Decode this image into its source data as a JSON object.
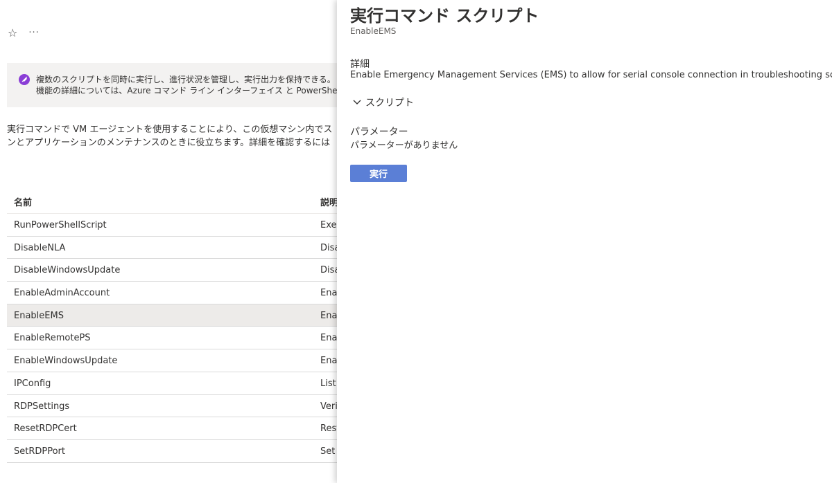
{
  "header": {
    "favorite_icon": "star-icon",
    "more_icon": "ellipsis-icon",
    "more_label": "···"
  },
  "info_banner": {
    "icon": "rocket-icon",
    "line1": "複数のスクリプトを同時に実行し、進行状況を管理し、実行出力を保持できる。",
    "line2": "機能の詳細については、Azure コマンド ライン インターフェイス と PowerShell"
  },
  "description": {
    "line1": "実行コマンドで VM エージェントを使用することにより、この仮想マシン内でス",
    "line2": "ンとアプリケーションのメンテナンスのときに役立ちます。詳細を確認するには"
  },
  "table": {
    "headers": [
      "名前",
      "説明"
    ],
    "rows": [
      {
        "name": "RunPowerShellScript",
        "desc": "Exec"
      },
      {
        "name": "DisableNLA",
        "desc": "Disa"
      },
      {
        "name": "DisableWindowsUpdate",
        "desc": "Disa"
      },
      {
        "name": "EnableAdminAccount",
        "desc": "Enal"
      },
      {
        "name": "EnableEMS",
        "desc": "Enal",
        "selected": true
      },
      {
        "name": "EnableRemotePS",
        "desc": "Enal"
      },
      {
        "name": "EnableWindowsUpdate",
        "desc": "Enal"
      },
      {
        "name": "IPConfig",
        "desc": "List"
      },
      {
        "name": "RDPSettings",
        "desc": "Veri"
      },
      {
        "name": "ResetRDPCert",
        "desc": "Rest"
      },
      {
        "name": "SetRDPPort",
        "desc": "Set"
      }
    ]
  },
  "panel": {
    "title": "実行コマンド スクリプト",
    "subtitle": "EnableEMS",
    "details_label": "詳細",
    "details_text": "Enable Emergency Management Services (EMS) to allow for serial console connection in troubleshooting scenarios.",
    "script_toggle_icon": "chevron-down-icon",
    "script_label": "スクリプト",
    "parameters_label": "パラメーター",
    "parameters_value": "パラメーターがありません",
    "run_button": "実行"
  },
  "colors": {
    "accent": "#5b7fd6",
    "info_icon": "#8a3ed6",
    "selected_row": "#edebe9"
  }
}
